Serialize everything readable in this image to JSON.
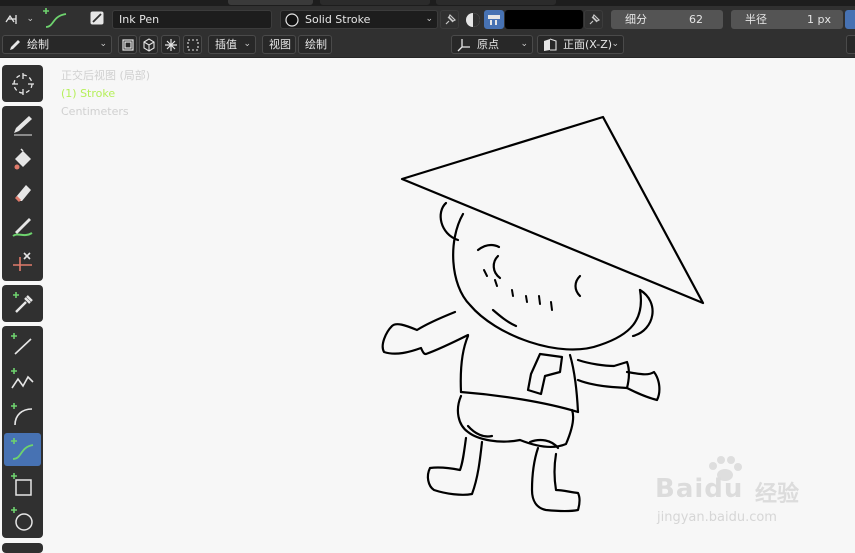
{
  "header": {
    "mode_icon": "object-mode-icon",
    "brush_name": "Ink Pen",
    "material_name": "Solid Stroke",
    "subdivide_label": "细分",
    "subdivide_value": "62",
    "radius_label": "半径",
    "radius_value": "1 px"
  },
  "header2": {
    "mode_label": "绘制",
    "interpolate_label": "插值",
    "view_menu": "视图",
    "draw_menu": "绘制",
    "origin_label": "原点",
    "orientation_label": "正面(X-Z)"
  },
  "viewport_overlay": {
    "view_name": "正交后视图 (局部)",
    "object_name": "(1) Stroke",
    "units": "Centimeters"
  },
  "toolbar": {
    "tools": [
      "cursor-tool",
      "draw-tool",
      "fill-tool",
      "erase-tool",
      "tint-tool",
      "cutter-tool",
      "eyedropper-tool",
      "line-tool",
      "polyline-tool",
      "arc-tool",
      "curve-tool",
      "box-tool",
      "circle-tool"
    ],
    "active_tool": "curve-tool"
  },
  "watermark": {
    "main": "Bai",
    "main2": "du",
    "cn": "经验",
    "sub": "jingyan.baidu.com"
  },
  "colors": {
    "accent": "#4772b3",
    "header_bg": "#303030",
    "viewport_bg": "#f7f7f7",
    "stroke": "#000000",
    "active_object_text": "#b6f05b"
  }
}
